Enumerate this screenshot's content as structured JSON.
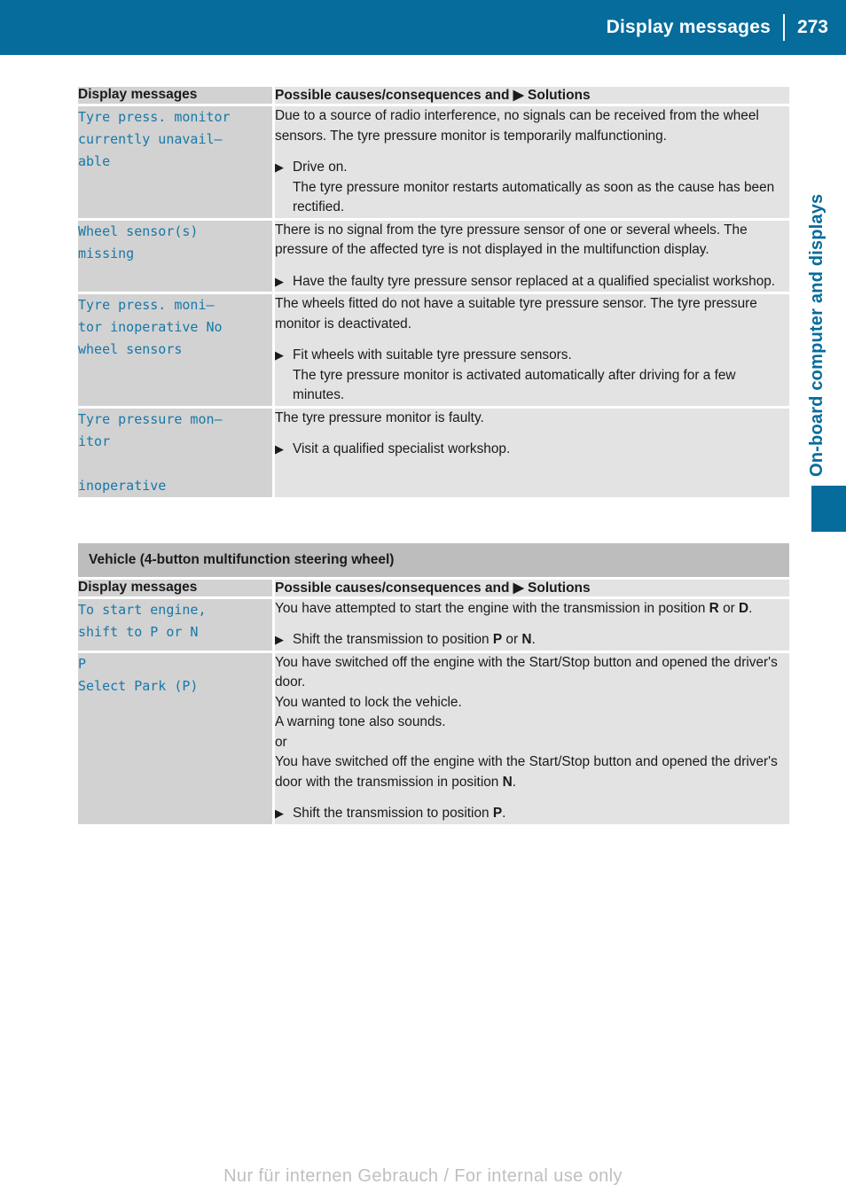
{
  "header": {
    "title": "Display messages",
    "page_number": "273"
  },
  "side_tab": {
    "label": "On-board computer and displays"
  },
  "tables": [
    {
      "columns": {
        "left": "Display messages",
        "right_prefix": "Possible causes/consequences and",
        "right_marker": "▶",
        "right_suffix": "Solutions"
      },
      "rows": [
        {
          "message": "Tyre press. monitor currently unavail–\nable",
          "paragraphs": [
            "Due to a source of radio interference, no signals can be received from the wheel sensors. The tyre pressure monitor is temporarily malfunctioning."
          ],
          "bullets": [
            {
              "text": "Drive on.",
              "sub": "The tyre pressure monitor restarts automatically as soon as the cause has been rectified."
            }
          ]
        },
        {
          "message": "Wheel sensor(s)\nmissing",
          "paragraphs": [
            "There is no signal from the tyre pressure sensor of one or several wheels. The pressure of the affected tyre is not displayed in the multifunction display."
          ],
          "bullets": [
            {
              "text": "Have the faulty tyre pressure sensor replaced at a qualified specialist workshop.",
              "sub": ""
            }
          ]
        },
        {
          "message": "Tyre press. moni–\ntor inoperative No\nwheel sensors",
          "paragraphs": [
            "The wheels fitted do not have a suitable tyre pressure sensor. The tyre pressure monitor is deactivated."
          ],
          "bullets": [
            {
              "text": "Fit wheels with suitable tyre pressure sensors.",
              "sub": "The tyre pressure monitor is activated automatically after driving for a few minutes."
            }
          ]
        },
        {
          "message": "Tyre pressure mon–\nitor\n\ninoperative",
          "paragraphs": [
            "The tyre pressure monitor is faulty."
          ],
          "bullets": [
            {
              "text": "Visit a qualified specialist workshop.",
              "sub": ""
            }
          ]
        }
      ]
    },
    {
      "section_title": "Vehicle (4-button multifunction steering wheel)",
      "columns": {
        "left": "Display messages",
        "right_prefix": "Possible causes/consequences and",
        "right_marker": "▶",
        "right_suffix": "Solutions"
      },
      "rows": [
        {
          "message": "To start engine,\nshift to P or N",
          "paragraphs_rich": [
            "You have attempted to start the engine with the transmission in position <b>R</b> or <b>D</b>."
          ],
          "bullets_rich": [
            {
              "text": "Shift the transmission to position <b>P</b> or <b>N</b>.",
              "sub": ""
            }
          ]
        },
        {
          "message": "P\nSelect Park (P)",
          "paragraphs_rich": [
            "You have switched off the engine with the Start/Stop button and opened the driver's door.",
            "You wanted to lock the vehicle.",
            "A warning tone also sounds.",
            "or",
            "You have switched off the engine with the Start/Stop button and opened the driver's door with the transmission in position <b>N</b>."
          ],
          "bullets_rich": [
            {
              "text": "Shift the transmission to position <b>P</b>.",
              "sub": ""
            }
          ]
        }
      ]
    }
  ],
  "footer": {
    "watermark": "Nur für internen Gebrauch / For internal use only"
  },
  "colors": {
    "brand_blue": "#056C9C",
    "message_text": "#1778A8",
    "cell_left_bg": "#D2D2D2",
    "cell_right_bg": "#E3E3E3",
    "section_title_bg": "#BDBDBD",
    "watermark": "#BFBFBF"
  }
}
